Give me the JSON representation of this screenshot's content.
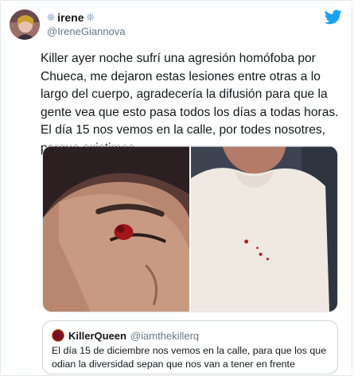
{
  "author": {
    "display_name": "irene",
    "name_decoration": "❊",
    "handle": "@IreneGiannova"
  },
  "tweet": {
    "text": "Killer ayer noche sufrí una agresión homófoba por Chueca, me dejaron estas lesiones entre otras a lo largo del cuerpo, agradecería la difusión para que la gente vea que esto pasa todos los días a todas horas. El día 15 nos vemos en la calle, por todes nosotres, porque existimos."
  },
  "quoted_tweet": {
    "display_name": "KillerQueen",
    "handle": "@iamthekillerq",
    "text": "El día 15 de diciembre nos vemos en la calle, para que los que odian la diversidad sepan que nos van a tener en frente"
  },
  "colors": {
    "brand": "#1da1f2",
    "text": "#14171a",
    "secondary": "#657786",
    "border": "#e1e8ed"
  },
  "icons": {
    "logo": "twitter-bird-icon"
  }
}
